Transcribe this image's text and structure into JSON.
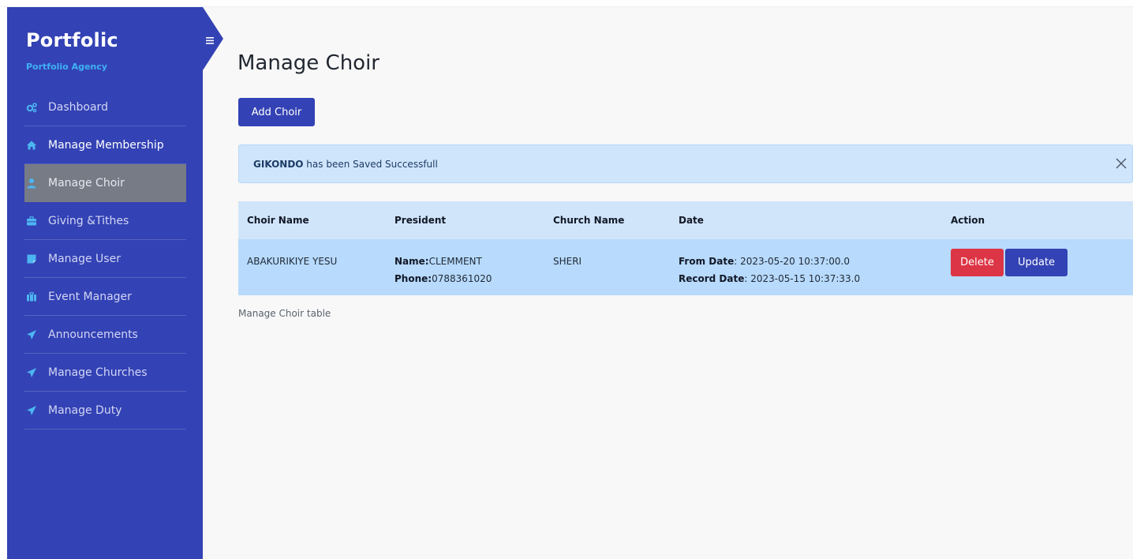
{
  "brand": {
    "title": "Portfolic",
    "subtitle": "Portfolio Agency"
  },
  "sidebar": {
    "toggle_icon": "menu-icon",
    "items": [
      {
        "label": "Dashboard",
        "icon": "cogs-icon",
        "state": "normal"
      },
      {
        "label": "Manage Membership",
        "icon": "home-icon",
        "state": "bold"
      },
      {
        "label": "Manage Choir",
        "icon": "user-icon",
        "state": "active"
      },
      {
        "label": "Giving &Tithes",
        "icon": "briefcase-icon",
        "state": "normal"
      },
      {
        "label": "Manage User",
        "icon": "note-icon",
        "state": "normal"
      },
      {
        "label": "Event Manager",
        "icon": "briefcase-icon",
        "state": "normal"
      },
      {
        "label": "Announcements",
        "icon": "send-icon",
        "state": "normal"
      },
      {
        "label": "Manage Churches",
        "icon": "send-icon",
        "state": "normal"
      },
      {
        "label": "Manage Duty",
        "icon": "send-icon",
        "state": "normal"
      }
    ]
  },
  "main": {
    "title": "Manage Choir",
    "add_button": "Add Choir",
    "alert": {
      "strong": "GIKONDO",
      "text": " has been Saved Successfull",
      "close_icon": "close-icon"
    },
    "table": {
      "headers": [
        "Choir Name",
        "President",
        "Church Name",
        "Date",
        "Action"
      ],
      "rows": [
        {
          "choir_name": "ABAKURIKIYE YESU",
          "president_name_label": "Name:",
          "president_name": "CLEMMENT",
          "president_phone_label": "Phone:",
          "president_phone": "0788361020",
          "church_name": "SHERI",
          "from_date_label": "From Date",
          "from_date": ": 2023-05-20 10:37:00.0",
          "record_date_label": "Record Date",
          "record_date": ": 2023-05-15 10:37:33.0",
          "delete_label": "Delete",
          "update_label": "Update"
        }
      ]
    },
    "caption": "Manage Choir table"
  },
  "colors": {
    "sidebar": "#3342b4",
    "accent_blue": "#4cb6f2",
    "active_item": "#777b86",
    "delete": "#dc3545",
    "alert_bg": "#cfe5fb",
    "table_header": "#d1e5fa",
    "table_row": "#b8dafc"
  }
}
